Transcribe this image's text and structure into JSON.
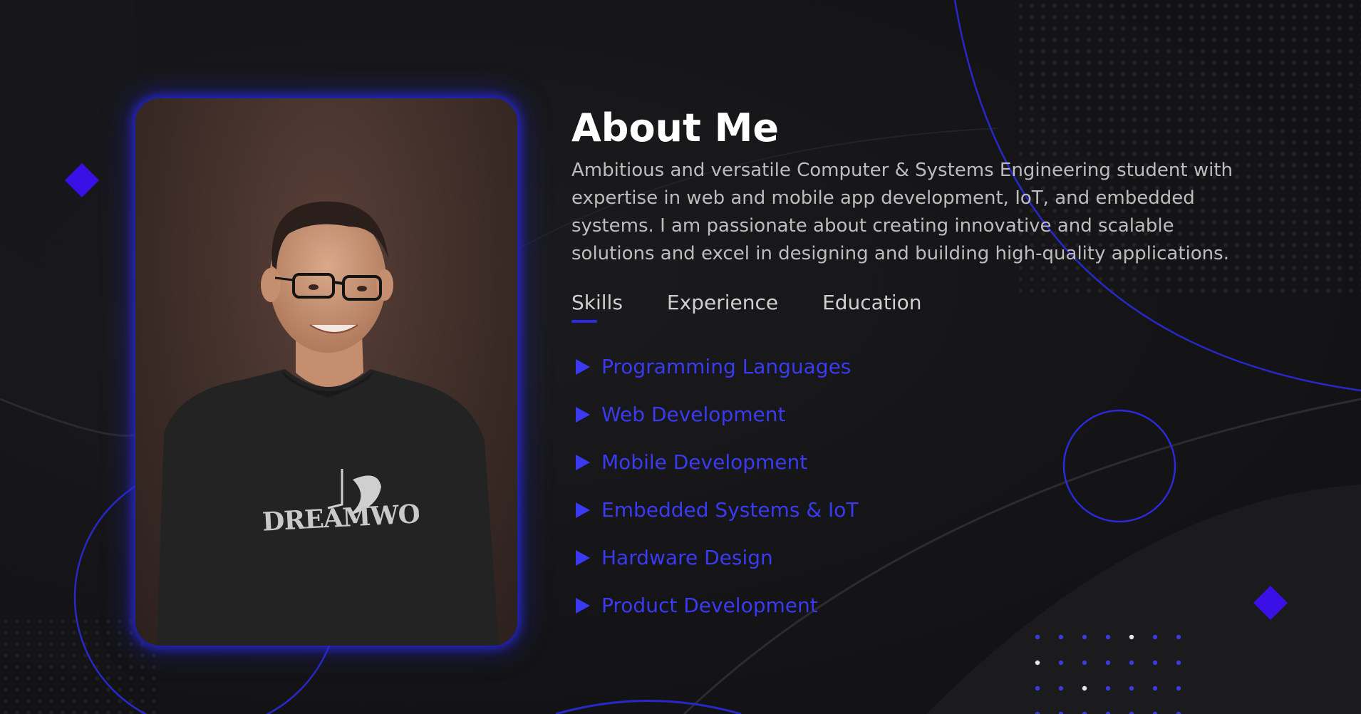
{
  "about": {
    "title": "About Me",
    "description": "Ambitious and versatile Computer & Systems Engineering student with expertise in web and mobile app development, IoT, and embedded systems. I am passionate about creating innovative and scalable solutions and excel in designing and building high-quality applications."
  },
  "tabs": [
    {
      "label": "Skills",
      "active": true
    },
    {
      "label": "Experience",
      "active": false
    },
    {
      "label": "Education",
      "active": false
    }
  ],
  "skills": [
    "Programming Languages",
    "Web Development",
    "Mobile Development",
    "Embedded Systems & IoT",
    "Hardware Design",
    "Product Development"
  ],
  "photo": {
    "shirt_text": "DREAMWORKS"
  },
  "colors": {
    "background": "#141416",
    "accent": "#3a3af2",
    "title": "#ffffff",
    "text": "#bdbdbd"
  },
  "icons": {
    "skill_bullet": "play-triangle-icon",
    "decor": "diamond-icon"
  }
}
